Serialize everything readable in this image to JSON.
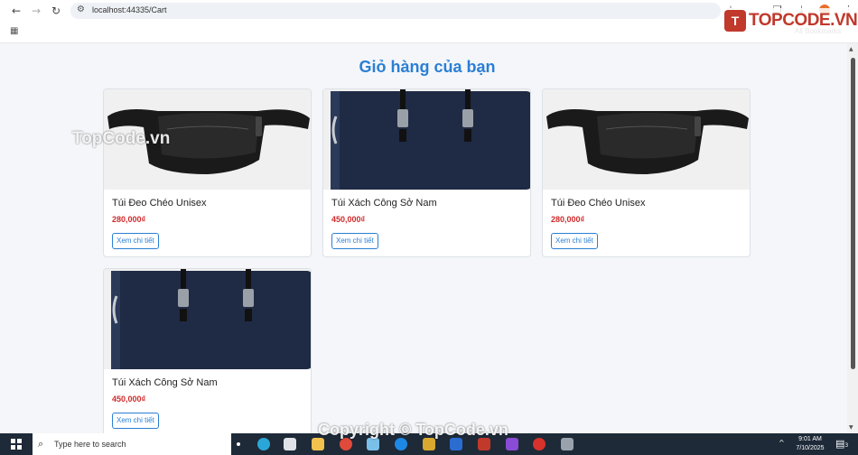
{
  "browser": {
    "url": "localhost:44335/Cart",
    "bookmarks_label": "All Bookmarks"
  },
  "watermark": {
    "logo_text": "TOPCODE.VN",
    "side_text": "TopCode.vn",
    "footer_text": "Copyright © TopCode.vn"
  },
  "page": {
    "title": "Giỏ hàng của bạn",
    "products": [
      {
        "name": "Túi Đeo Chéo Unisex",
        "price": "280,000₫",
        "button": "Xem chi tiết",
        "image": "black-waist-bag"
      },
      {
        "name": "Túi Xách Công Sở Nam",
        "price": "450,000₫",
        "button": "Xem chi tiết",
        "image": "navy-briefcase"
      },
      {
        "name": "Túi Đeo Chéo Unisex",
        "price": "280,000₫",
        "button": "Xem chi tiết",
        "image": "black-waist-bag"
      },
      {
        "name": "Túi Xách Công Sở Nam",
        "price": "450,000₫",
        "button": "Xem chi tiết",
        "image": "navy-briefcase"
      }
    ]
  },
  "taskbar": {
    "search_placeholder": "Type here to search",
    "time": "9:01 AM",
    "date": "7/10/2025",
    "notification_count": "3"
  },
  "colors": {
    "accent": "#2a7fd4",
    "price": "#d02a2a",
    "taskbar": "#1e2a38"
  }
}
